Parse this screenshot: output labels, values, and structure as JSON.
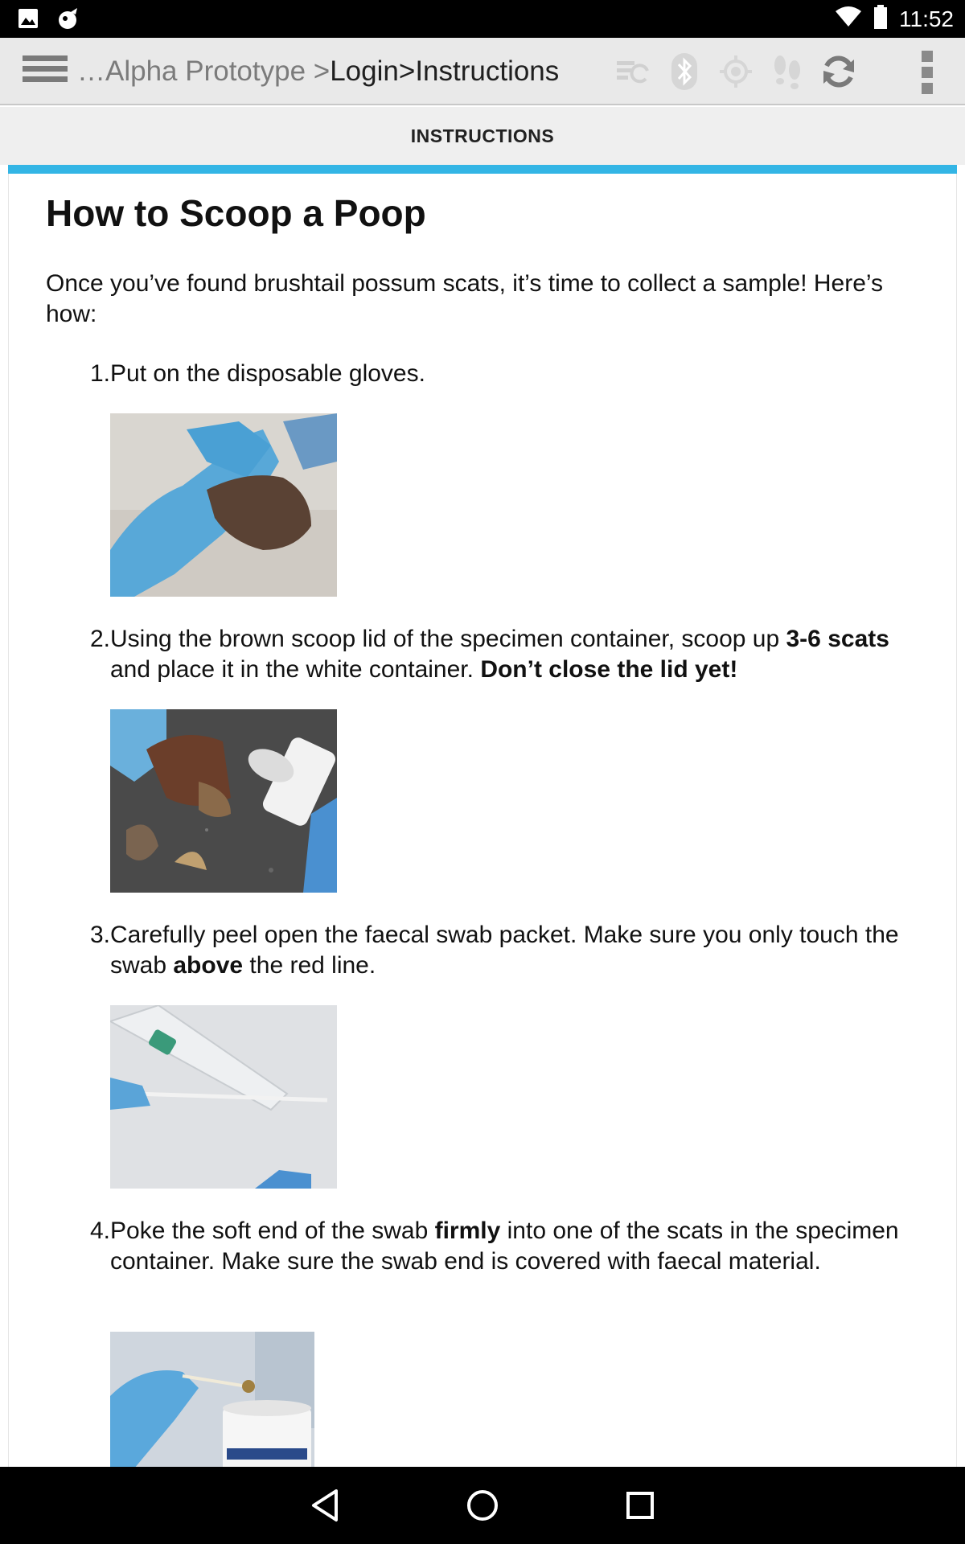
{
  "status_bar": {
    "time": "11:52",
    "left_icons": [
      "image-notification-icon",
      "app-notification-icon"
    ],
    "right_icons": [
      "wifi-icon",
      "battery-icon"
    ]
  },
  "action_bar": {
    "breadcrumb": {
      "prefix": "…Alpha Prototype > ",
      "login": "Login",
      "separator": " > ",
      "current": "Instructions"
    },
    "icons": [
      "sync-queue-icon",
      "bluetooth-icon",
      "gps-icon",
      "footsteps-icon",
      "refresh-icon"
    ],
    "overflow": "overflow-menu-icon"
  },
  "tab": {
    "label": "INSTRUCTIONS"
  },
  "accent_color": "#33b5e5",
  "article": {
    "title": "How to Scoop a Poop",
    "intro": "Once you’ve found brushtail possum scats, it’s time to collect a sample! Here’s how:",
    "steps": [
      {
        "number": "1.",
        "segments": [
          {
            "t": "Put on the disposable gloves.",
            "b": false
          }
        ]
      },
      {
        "number": "2.",
        "segments": [
          {
            "t": "Using the brown scoop lid of the specimen container, scoop up ",
            "b": false
          },
          {
            "t": "3-6 scats",
            "b": true
          },
          {
            "t": " and place it in the white container. ",
            "b": false
          },
          {
            "t": "Don’t close the lid yet!",
            "b": true
          }
        ]
      },
      {
        "number": "3.",
        "segments": [
          {
            "t": "Carefully peel open the faecal swab packet. Make sure you only touch the swab ",
            "b": false
          },
          {
            "t": "above",
            "b": true
          },
          {
            "t": " the red line.",
            "b": false
          }
        ]
      },
      {
        "number": "4.",
        "segments": [
          {
            "t": "Poke the soft end of the swab ",
            "b": false
          },
          {
            "t": "firmly",
            "b": true
          },
          {
            "t": " into one of the scats in the specimen container. Make sure the swab end is covered with faecal material.",
            "b": false
          }
        ]
      }
    ]
  },
  "nav_bar": {
    "buttons": [
      "back-icon",
      "home-icon",
      "recents-icon"
    ]
  }
}
